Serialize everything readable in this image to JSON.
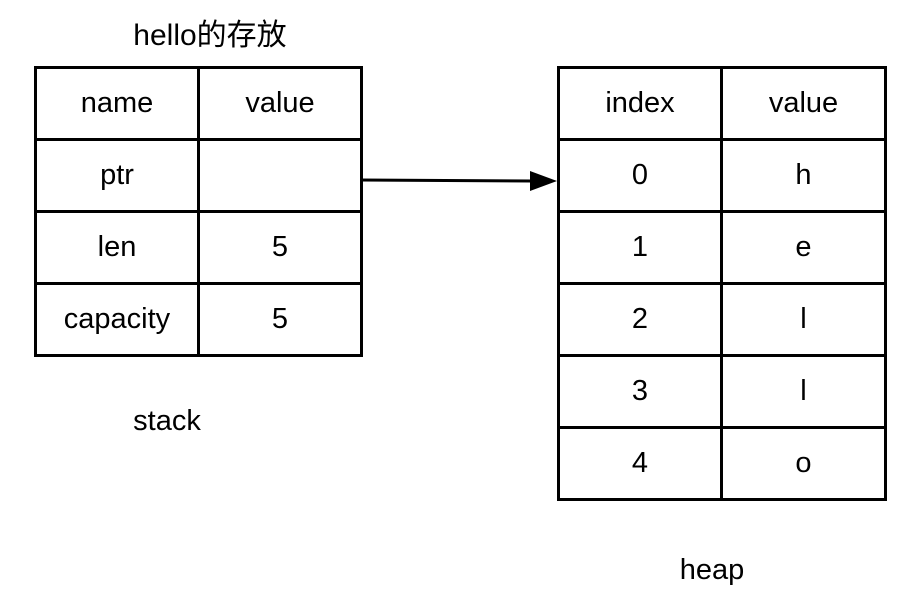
{
  "title": "hello的存放",
  "stack": {
    "caption": "stack",
    "header": {
      "name": "name",
      "value": "value"
    },
    "rows": [
      {
        "name": "ptr",
        "value": ""
      },
      {
        "name": "len",
        "value": "5"
      },
      {
        "name": "capacity",
        "value": "5"
      }
    ]
  },
  "heap": {
    "caption": "heap",
    "header": {
      "index": "index",
      "value": "value"
    },
    "rows": [
      {
        "index": "0",
        "value": "h"
      },
      {
        "index": "1",
        "value": "e"
      },
      {
        "index": "2",
        "value": "l"
      },
      {
        "index": "3",
        "value": "l"
      },
      {
        "index": "4",
        "value": "o"
      }
    ]
  }
}
